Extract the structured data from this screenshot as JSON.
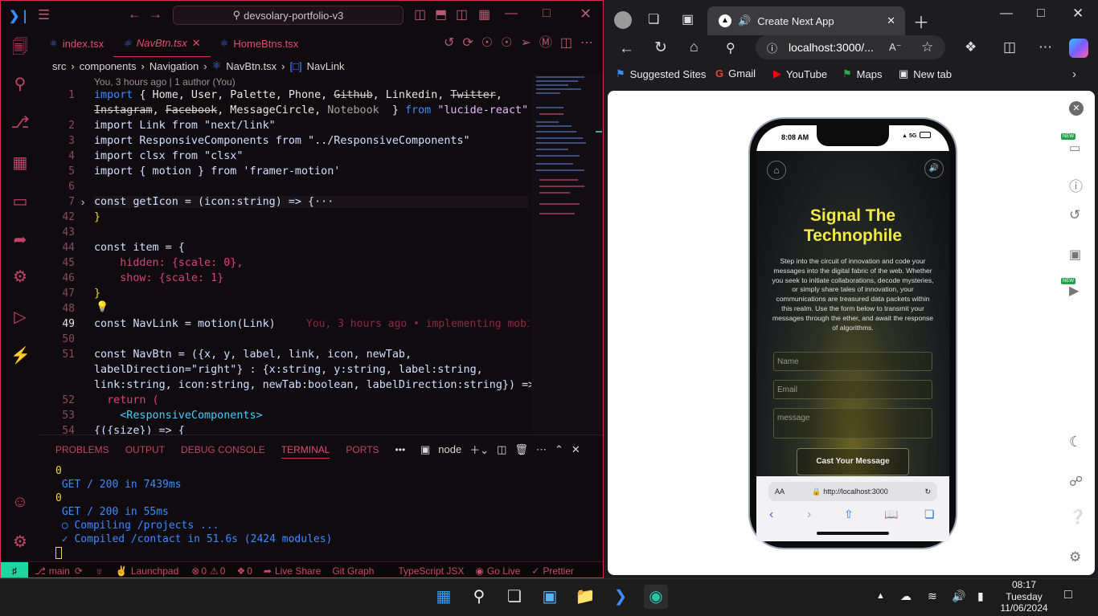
{
  "vscode": {
    "search": "devsolary-portfolio-v3",
    "tabs": [
      {
        "label": "index.tsx"
      },
      {
        "label": "NavBtn.tsx"
      },
      {
        "label": "HomeBtns.tsx"
      }
    ],
    "breadcrumb": [
      "src",
      "components",
      "Navigation",
      "NavBtn.tsx",
      "NavLink"
    ],
    "blame": "You, 3 hours ago | 1 author (You)",
    "line_numbers": [
      "1",
      "",
      "2",
      "3",
      "4",
      "5",
      "6",
      "7",
      "42",
      "43",
      "44",
      "45",
      "46",
      "47",
      "48",
      "49",
      "50",
      "51",
      "",
      "",
      "52",
      "53",
      "54"
    ],
    "code": {
      "l1a_import": "import",
      "l1a_names": "{ Home, User, Palette, Phone, ",
      "l1a_github": "Github",
      "l1a_mid": ", Linkedin, ",
      "l1a_twitter": "Twitter",
      "l1a_end": ",",
      "l1b_instagram": "Instagram",
      "l1b_c1": ", ",
      "l1b_facebook": "Facebook",
      "l1b_c2": ", MessageCircle, ",
      "l1b_notebook": "Notebook",
      "l1b_close": "  }",
      "l1b_from": "from",
      "l1b_str": "\"lucide-react\"",
      "l2": "import Link from \"next/link\"",
      "l3": "import ResponsiveComponents from \"../ResponsiveComponents\"",
      "l4": "import clsx from \"clsx\"",
      "l5": "import { motion } from 'framer-motion'",
      "l7": "const getIcon = (icon:string) => {···",
      "l42": "}",
      "l44": "const item = {",
      "l45": "    hidden: {scale: 0},",
      "l46": "    show: {scale: 1}",
      "l47": "}",
      "l49": "const NavLink = motion(Link)",
      "l49_blame": "You, 3 hours ago • implementing mobi",
      "l51a": "const NavBtn = ({x, y, label, link, icon, newTab,",
      "l51b": "labelDirection=\"right\"} : {x:string, y:string, label:string,",
      "l51c": "link:string, icon:string, newTab:boolean, labelDirection:string}) => {",
      "l52": "  return (",
      "l53": "    <ResponsiveComponents>",
      "l54": "{({size}) => {"
    },
    "panel_tabs": [
      "PROBLEMS",
      "OUTPUT",
      "DEBUG CONSOLE",
      "TERMINAL",
      "PORTS",
      "•••"
    ],
    "terminal_shell": "node",
    "terminal": [
      "0",
      " GET / 200 in 7439ms",
      "0",
      " GET / 200 in 55ms",
      " ○ Compiling /projects ...",
      " ✓ Compiled /contact in 51.6s (2424 modules)"
    ],
    "status": {
      "branch": "main",
      "launchpad": "Launchpad",
      "errors": "0",
      "warnings": "0",
      "ports": "0",
      "live_share": "Live Share",
      "git_graph": "Git Graph",
      "lang": "TypeScript JSX",
      "go_live": "Go Live",
      "prettier": "Prettier"
    }
  },
  "browser": {
    "tab_title": "Create Next App",
    "address": "localhost:3000/...",
    "favorites": [
      "Suggested Sites",
      "Gmail",
      "YouTube",
      "Maps",
      "New tab"
    ],
    "sidebar_badge": "NEW"
  },
  "phone": {
    "time": "8:08 AM",
    "signal": "5G",
    "headline_1": "Signal The",
    "headline_2": "Technophile",
    "body": "Step into the circuit of innovation and code your messages into the digital fabric of the web. Whether you seek to initiate collaborations, decode mysteries, or simply share tales of innovation, your communications are treasured data packets within this realm. Use the form below to transmit your messages through the ether, and await the response of algorithms.",
    "name_placeholder": "Name",
    "email_placeholder": "Email",
    "message_placeholder": "message",
    "submit": "Cast Your Message",
    "safari_aa": "AA",
    "safari_url": "http://localhost:3000"
  },
  "taskbar": {
    "time": "08:17",
    "day": "Tuesday",
    "date": "11/06/2024"
  },
  "colors": {
    "vscode_accent": "#e02a55",
    "keyword": "#3a8cff",
    "string": "#e0b8ff",
    "terminal_text": "#3a8cff",
    "success": "#3fbf4a",
    "phone_headline": "#f2e84a"
  }
}
